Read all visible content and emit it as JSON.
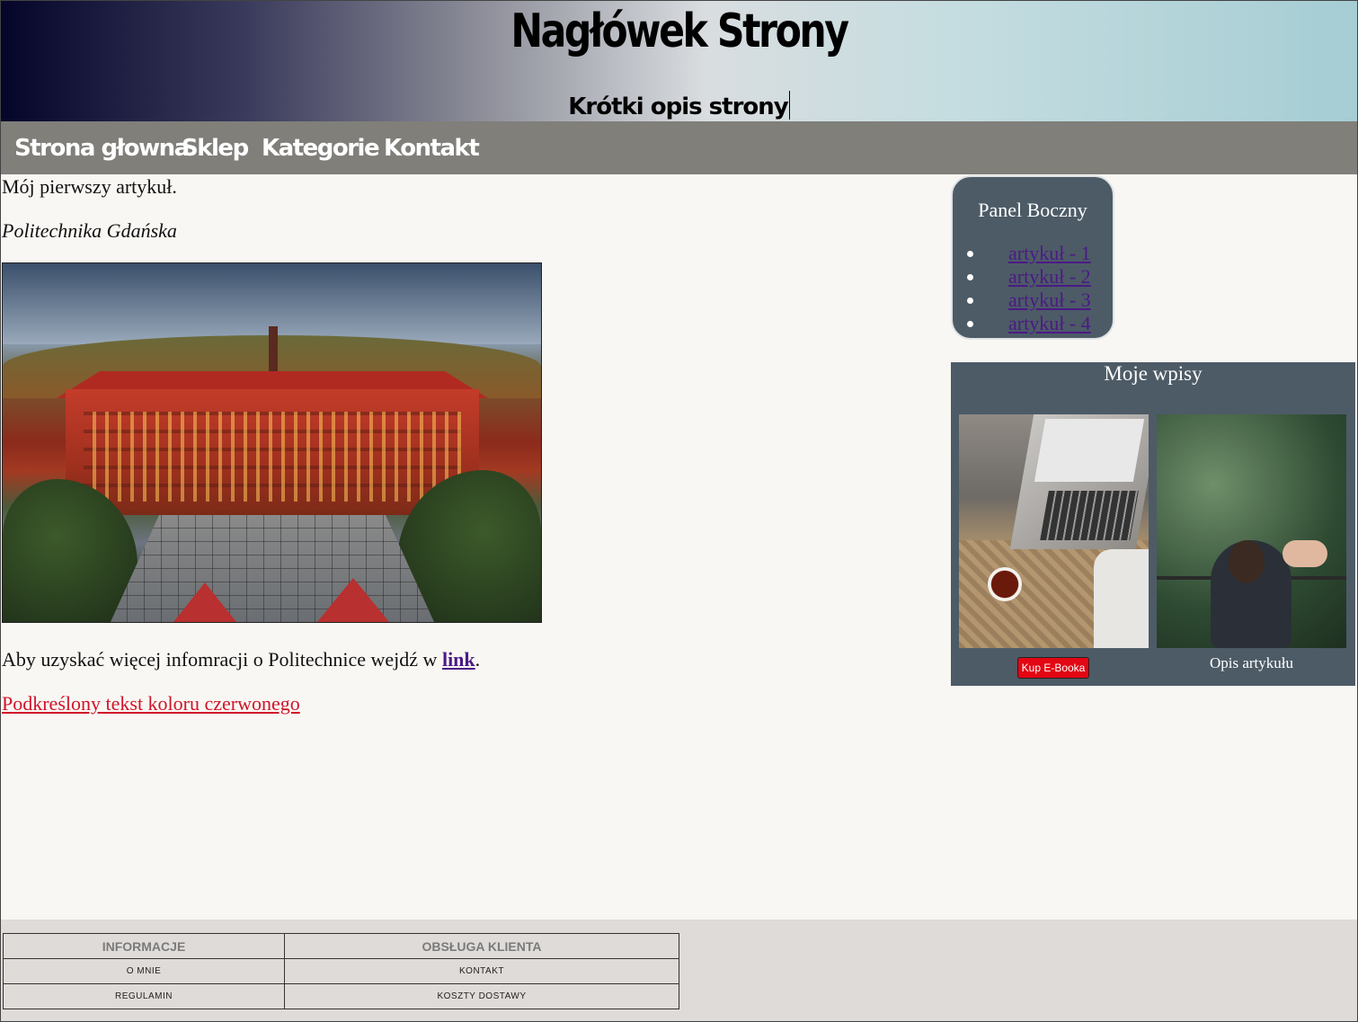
{
  "header": {
    "title": "Nagłówek Strony",
    "subtitle": "Krótki opis strony"
  },
  "nav": {
    "items": [
      {
        "label": "Strona głowna"
      },
      {
        "label": "Sklep"
      },
      {
        "label": "Kategorie"
      },
      {
        "label": "Kontakt"
      }
    ]
  },
  "article": {
    "title": "Mój pierwszy artykuł.",
    "caption": "Politechnika Gdańska",
    "image": "politechnika-gdanska-photo",
    "more_prefix": "Aby uzyskać więcej infomracji o Politechnice wejdź w ",
    "more_link": "link",
    "more_suffix": ".",
    "red_text": "Podkreślony tekst koloru czerwonego"
  },
  "side_panel": {
    "title": "Panel Boczny",
    "links": [
      "artykuł - 1",
      "artykuł - 2",
      "artykuł - 3",
      "artykuł - 4"
    ]
  },
  "posts": {
    "title": "Moje wpisy",
    "buy_button": "Kup E-Booka",
    "description": "Opis artykułu"
  },
  "footer": {
    "headers": [
      "INFORMACJE",
      "OBSŁUGA KLIENTA"
    ],
    "rows": [
      [
        "O MNIE",
        "KONTAKT"
      ],
      [
        "REGULAMIN",
        "KOSZTY DOSTAWY"
      ]
    ]
  },
  "colors": {
    "nav_bg": "#807f7a",
    "panel_bg": "#4d5b66",
    "link": "#4b1a86",
    "red_text": "#d0142a",
    "buy_button": "#e30613",
    "footer_bg": "#dfdbd8"
  }
}
